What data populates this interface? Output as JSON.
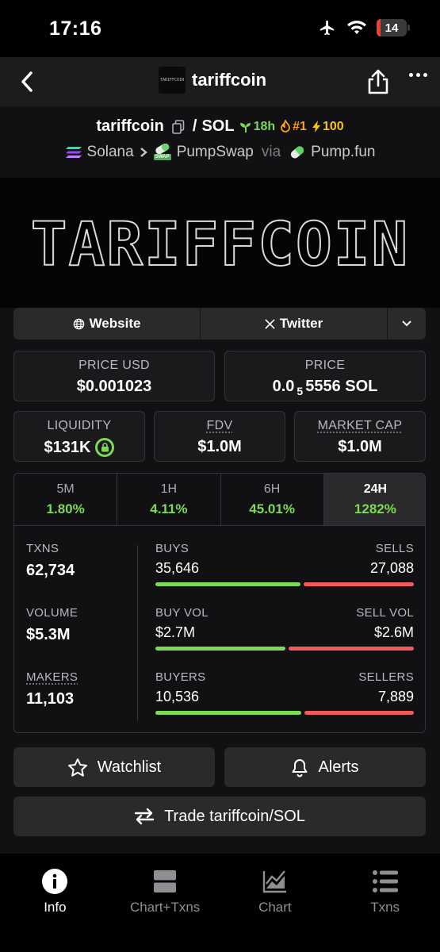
{
  "status": {
    "time": "17:16",
    "battery": "14",
    "battery_level": 0.14
  },
  "nav": {
    "title": "tariffcoin",
    "logo_text": "TARIFFCOIN"
  },
  "pair": {
    "base": "tariffcoin",
    "separator": "/",
    "quote": "SOL",
    "age": "18h",
    "rank": "#1",
    "boost": "100",
    "chain": "Solana",
    "dex": "PumpSwap",
    "via": "via",
    "launchpad": "Pump.fun",
    "swap_chip": "SWAP"
  },
  "banner": {
    "text": "TARIFFCOIN"
  },
  "links": {
    "website": "Website",
    "twitter": "Twitter"
  },
  "stats": {
    "price_usd_label": "PRICE USD",
    "price_usd": "$0.001023",
    "price_label": "PRICE",
    "price_prefix": "0.0",
    "price_sub": "5",
    "price_suffix": "5556 SOL",
    "liquidity_label": "LIQUIDITY",
    "liquidity": "$131K",
    "fdv_label": "FDV",
    "fdv": "$1.0M",
    "mcap_label": "MARKET CAP",
    "mcap": "$1.0M"
  },
  "timeframes": [
    {
      "label": "5M",
      "value": "1.80%"
    },
    {
      "label": "1H",
      "value": "4.11%"
    },
    {
      "label": "6H",
      "value": "45.01%"
    },
    {
      "label": "24H",
      "value": "1282%"
    }
  ],
  "txns": {
    "txns_label": "TXNS",
    "txns": "62,734",
    "buys_label": "BUYS",
    "buys": "35,646",
    "sells_label": "SELLS",
    "sells": "27,088",
    "volume_label": "VOLUME",
    "volume": "$5.3M",
    "buy_vol_label": "BUY VOL",
    "buy_vol": "$2.7M",
    "sell_vol_label": "SELL VOL",
    "sell_vol": "$2.6M",
    "makers_label": "MAKERS",
    "makers": "11,103",
    "buyers_label": "BUYERS",
    "buyers": "10,536",
    "sellers_label": "SELLERS",
    "sellers": "7,889",
    "buys_ratio": 0.568,
    "buy_vol_ratio": 0.509,
    "buyers_ratio": 0.572
  },
  "actions": {
    "watchlist": "Watchlist",
    "alerts": "Alerts",
    "trade": "Trade tariffcoin/SOL"
  },
  "tabs": [
    {
      "label": "Info",
      "icon": "info-icon"
    },
    {
      "label": "Chart+Txns",
      "icon": "split-view-icon"
    },
    {
      "label": "Chart",
      "icon": "area-chart-icon"
    },
    {
      "label": "Txns",
      "icon": "list-icon"
    }
  ],
  "colors": {
    "green": "#7ed957",
    "red": "#f05a5a",
    "panel": "#111113",
    "button": "#2a2a2d"
  }
}
